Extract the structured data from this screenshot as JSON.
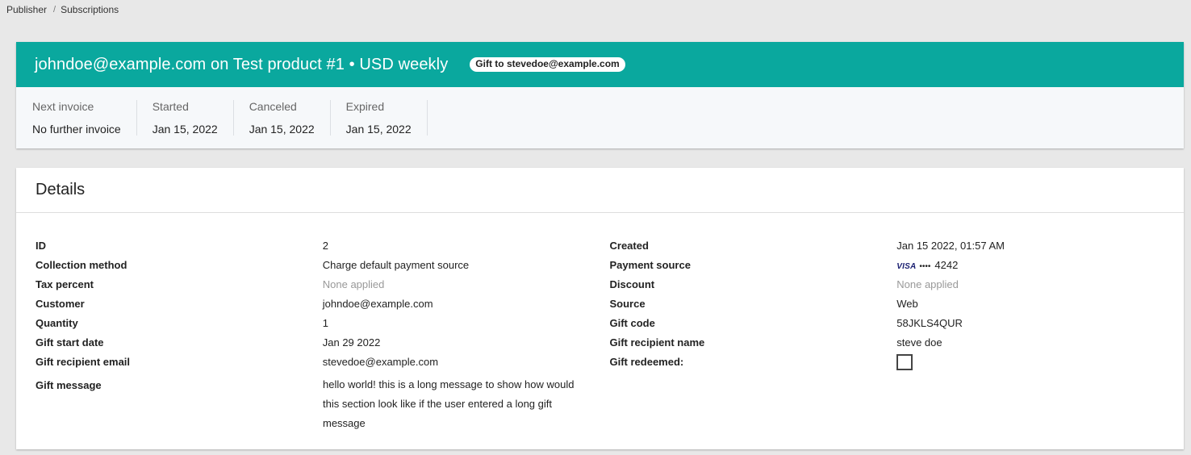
{
  "breadcrumb": {
    "items": [
      "Publisher",
      "Subscriptions"
    ],
    "separator": "/"
  },
  "header": {
    "title": "johndoe@example.com on Test product #1 • USD weekly",
    "badge": "Gift to stevedoe@example.com",
    "accent_color": "#0aa89e",
    "stats": [
      {
        "label": "Next invoice",
        "value": "No further invoice"
      },
      {
        "label": "Started",
        "value": "Jan 15, 2022"
      },
      {
        "label": "Canceled",
        "value": "Jan 15, 2022"
      },
      {
        "label": "Expired",
        "value": "Jan 15, 2022"
      }
    ]
  },
  "details": {
    "title": "Details",
    "left": [
      {
        "key": "ID",
        "value": "2"
      },
      {
        "key": "Collection method",
        "value": "Charge default payment source"
      },
      {
        "key": "Tax percent",
        "value": "None applied"
      },
      {
        "key": "Customer",
        "value": "johndoe@example.com"
      },
      {
        "key": "Quantity",
        "value": "1"
      },
      {
        "key": "Gift start date",
        "value": "Jan 29 2022"
      },
      {
        "key": "Gift recipient email",
        "value": "stevedoe@example.com"
      },
      {
        "key": "Gift message",
        "value": "hello world! this is a long message to show how would this section look like if the user entered a long gift message"
      }
    ],
    "right": [
      {
        "key": "Created",
        "value": "Jan 15 2022, 01:57 AM"
      },
      {
        "key": "Payment source",
        "brand": "VISA",
        "dots": "••••",
        "last4": "4242"
      },
      {
        "key": "Discount",
        "value": "None applied"
      },
      {
        "key": "Source",
        "value": "Web"
      },
      {
        "key": "Gift code",
        "value": "58JKLS4QUR"
      },
      {
        "key": "Gift recipient name",
        "value": "steve doe"
      },
      {
        "key": "Gift redeemed:",
        "checked": false
      }
    ]
  }
}
